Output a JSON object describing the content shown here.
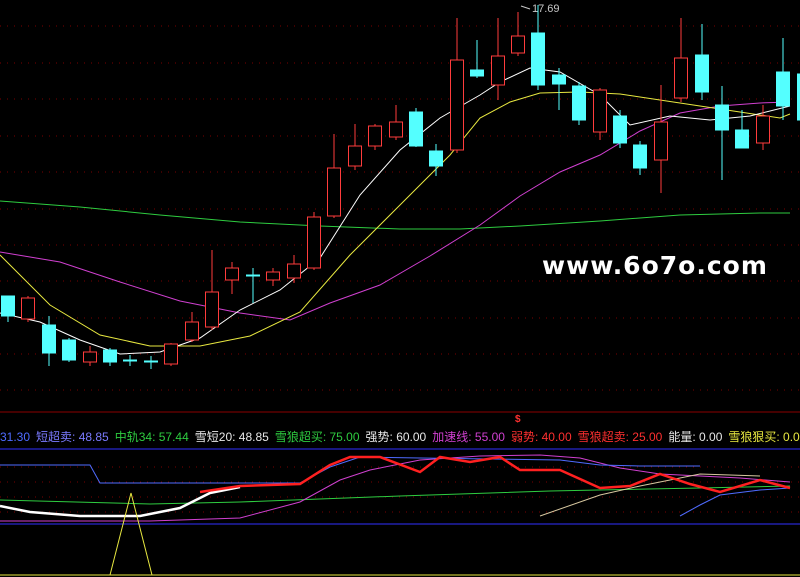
{
  "watermark": "www.6o7o.com",
  "peak_label": "17.69",
  "marker_symbol": "$",
  "legend": [
    {
      "text": "31.30",
      "color": "#4f6bff"
    },
    {
      "text": "短超卖: 48.85",
      "color": "#7b7bff"
    },
    {
      "text": "中轨34: 57.44",
      "color": "#2ecc40"
    },
    {
      "text": "雪短20: 48.85",
      "color": "#e8e8e8"
    },
    {
      "text": "雪狼超买: 75.00",
      "color": "#2ecc40"
    },
    {
      "text": "强势: 60.00",
      "color": "#e8e8e8"
    },
    {
      "text": "加速线: 55.00",
      "color": "#d040d0"
    },
    {
      "text": "弱势: 40.00",
      "color": "#ff3030"
    },
    {
      "text": "雪狼超卖: 25.00",
      "color": "#ff3030"
    },
    {
      "text": "能量: 0.00",
      "color": "#e8e8e8"
    },
    {
      "text": "雪狼狠买: 0.0",
      "color": "#e8e840"
    }
  ],
  "chart_data": {
    "type": "candlestick",
    "candles": [
      {
        "o": 296,
        "c": 316,
        "h": 296,
        "l": 322
      },
      {
        "o": 319,
        "c": 298,
        "h": 296,
        "l": 322
      },
      {
        "o": 325,
        "c": 353,
        "h": 316,
        "l": 366
      },
      {
        "o": 340,
        "c": 360,
        "h": 338,
        "l": 362
      },
      {
        "o": 362,
        "c": 352,
        "h": 346,
        "l": 366
      },
      {
        "o": 350,
        "c": 362,
        "h": 348,
        "l": 366
      },
      {
        "o": 360,
        "c": 360,
        "h": 355,
        "l": 366
      },
      {
        "o": 361,
        "c": 361,
        "h": 356,
        "l": 369
      },
      {
        "o": 364,
        "c": 344,
        "h": 343,
        "l": 366
      },
      {
        "o": 340,
        "c": 322,
        "h": 312,
        "l": 342
      },
      {
        "o": 327,
        "c": 292,
        "h": 250,
        "l": 330
      },
      {
        "o": 280,
        "c": 268,
        "h": 262,
        "l": 294
      },
      {
        "o": 275,
        "c": 275,
        "h": 268,
        "l": 303
      },
      {
        "o": 280,
        "c": 272,
        "h": 268,
        "l": 286
      },
      {
        "o": 278,
        "c": 264,
        "h": 255,
        "l": 283
      },
      {
        "o": 268,
        "c": 217,
        "h": 212,
        "l": 270
      },
      {
        "o": 216,
        "c": 168,
        "h": 134,
        "l": 218
      },
      {
        "o": 166,
        "c": 146,
        "h": 124,
        "l": 170
      },
      {
        "o": 146,
        "c": 126,
        "h": 124,
        "l": 150
      },
      {
        "o": 137,
        "c": 122,
        "h": 105,
        "l": 140
      },
      {
        "o": 112,
        "c": 146,
        "h": 108,
        "l": 147
      },
      {
        "o": 151,
        "c": 166,
        "h": 144,
        "l": 176
      },
      {
        "o": 150,
        "c": 60,
        "h": 18,
        "l": 153
      },
      {
        "o": 70,
        "c": 76,
        "h": 40,
        "l": 78
      },
      {
        "o": 85,
        "c": 56,
        "h": 18,
        "l": 100
      },
      {
        "o": 53,
        "c": 36,
        "h": 12,
        "l": 56
      },
      {
        "o": 33,
        "c": 85,
        "h": 5,
        "l": 90
      },
      {
        "o": 75,
        "c": 84,
        "h": 68,
        "l": 110
      },
      {
        "o": 86,
        "c": 120,
        "h": 82,
        "l": 125
      },
      {
        "o": 132,
        "c": 90,
        "h": 88,
        "l": 140
      },
      {
        "o": 116,
        "c": 143,
        "h": 110,
        "l": 148
      },
      {
        "o": 145,
        "c": 168,
        "h": 141,
        "l": 175
      },
      {
        "o": 160,
        "c": 122,
        "h": 85,
        "l": 193
      },
      {
        "o": 98,
        "c": 58,
        "h": 18,
        "l": 102
      },
      {
        "o": 55,
        "c": 92,
        "h": 24,
        "l": 100
      },
      {
        "o": 105,
        "c": 130,
        "h": 86,
        "l": 180
      },
      {
        "o": 130,
        "c": 148,
        "h": 110,
        "l": 148
      },
      {
        "o": 143,
        "c": 116,
        "h": 105,
        "l": 150
      },
      {
        "o": 72,
        "c": 106,
        "h": 38,
        "l": 120
      },
      {
        "o": 74,
        "c": 120,
        "h": 58,
        "l": 122
      }
    ],
    "ma_white": [
      [
        0,
        313
      ],
      [
        40,
        322
      ],
      [
        80,
        340
      ],
      [
        120,
        354
      ],
      [
        160,
        352
      ],
      [
        200,
        338
      ],
      [
        240,
        310
      ],
      [
        280,
        290
      ],
      [
        320,
        258
      ],
      [
        360,
        195
      ],
      [
        400,
        150
      ],
      [
        440,
        118
      ],
      [
        480,
        95
      ],
      [
        500,
        82
      ],
      [
        530,
        68
      ],
      [
        560,
        72
      ],
      [
        600,
        95
      ],
      [
        630,
        125
      ],
      [
        670,
        116
      ],
      [
        710,
        120
      ],
      [
        750,
        116
      ],
      [
        790,
        106
      ]
    ],
    "ma_yellow": [
      [
        0,
        255
      ],
      [
        50,
        305
      ],
      [
        100,
        335
      ],
      [
        150,
        346
      ],
      [
        200,
        346
      ],
      [
        250,
        336
      ],
      [
        300,
        312
      ],
      [
        350,
        255
      ],
      [
        400,
        205
      ],
      [
        450,
        155
      ],
      [
        480,
        118
      ],
      [
        510,
        102
      ],
      [
        540,
        93
      ],
      [
        580,
        92
      ],
      [
        620,
        94
      ],
      [
        660,
        100
      ],
      [
        700,
        106
      ],
      [
        740,
        112
      ],
      [
        780,
        118
      ],
      [
        790,
        114
      ]
    ],
    "ma_magenta": [
      [
        0,
        252
      ],
      [
        60,
        262
      ],
      [
        120,
        282
      ],
      [
        180,
        301
      ],
      [
        240,
        313
      ],
      [
        290,
        320
      ],
      [
        330,
        303
      ],
      [
        380,
        285
      ],
      [
        430,
        256
      ],
      [
        480,
        225
      ],
      [
        520,
        196
      ],
      [
        560,
        172
      ],
      [
        600,
        155
      ],
      [
        640,
        131
      ],
      [
        680,
        113
      ],
      [
        720,
        106
      ],
      [
        760,
        103
      ],
      [
        790,
        102
      ]
    ],
    "ma_green": [
      [
        0,
        201
      ],
      [
        80,
        207
      ],
      [
        160,
        215
      ],
      [
        240,
        222
      ],
      [
        320,
        226
      ],
      [
        400,
        229
      ],
      [
        460,
        229
      ],
      [
        520,
        226
      ],
      [
        600,
        221
      ],
      [
        680,
        215
      ],
      [
        760,
        213
      ],
      [
        790,
        213
      ]
    ],
    "osc_lines": {
      "red": [
        [
          200,
          492
        ],
        [
          240,
          486
        ],
        [
          300,
          484
        ],
        [
          330,
          465
        ],
        [
          350,
          457
        ],
        [
          380,
          457
        ],
        [
          420,
          472
        ],
        [
          440,
          457
        ],
        [
          470,
          462
        ],
        [
          500,
          457
        ],
        [
          520,
          470
        ],
        [
          560,
          470
        ],
        [
          600,
          488
        ],
        [
          630,
          486
        ],
        [
          660,
          474
        ],
        [
          690,
          484
        ],
        [
          720,
          492
        ],
        [
          760,
          480
        ],
        [
          790,
          488
        ]
      ],
      "white": [
        [
          0,
          506
        ],
        [
          30,
          512
        ],
        [
          80,
          516
        ],
        [
          140,
          516
        ],
        [
          180,
          508
        ],
        [
          210,
          493
        ],
        [
          240,
          487
        ]
      ],
      "magenta": [
        [
          0,
          521
        ],
        [
          150,
          521
        ],
        [
          240,
          518
        ],
        [
          300,
          502
        ],
        [
          340,
          480
        ],
        [
          370,
          470
        ],
        [
          420,
          460
        ],
        [
          480,
          456
        ],
        [
          540,
          455
        ],
        [
          580,
          458
        ],
        [
          620,
          468
        ],
        [
          660,
          474
        ],
        [
          700,
          476
        ],
        [
          740,
          478
        ],
        [
          790,
          482
        ]
      ],
      "green": [
        [
          0,
          500
        ],
        [
          150,
          504
        ],
        [
          240,
          502
        ],
        [
          400,
          496
        ],
        [
          550,
          491
        ],
        [
          700,
          488
        ],
        [
          790,
          486
        ]
      ],
      "blue": [
        [
          0,
          465
        ],
        [
          90,
          465
        ],
        [
          100,
          483
        ],
        [
          300,
          483
        ],
        [
          330,
          467
        ],
        [
          360,
          457
        ],
        [
          420,
          458
        ],
        [
          560,
          460
        ],
        [
          600,
          465
        ],
        [
          640,
          466
        ],
        [
          700,
          466
        ]
      ],
      "blue2": [
        [
          680,
          516
        ],
        [
          700,
          505
        ],
        [
          720,
          495
        ],
        [
          760,
          490
        ],
        [
          790,
          488
        ]
      ],
      "beige": [
        [
          540,
          516
        ],
        [
          600,
          495
        ],
        [
          640,
          486
        ],
        [
          700,
          474
        ],
        [
          760,
          476
        ]
      ],
      "yellow_spike": [
        [
          110,
          575
        ],
        [
          131,
          493
        ],
        [
          152,
          575
        ]
      ]
    }
  }
}
